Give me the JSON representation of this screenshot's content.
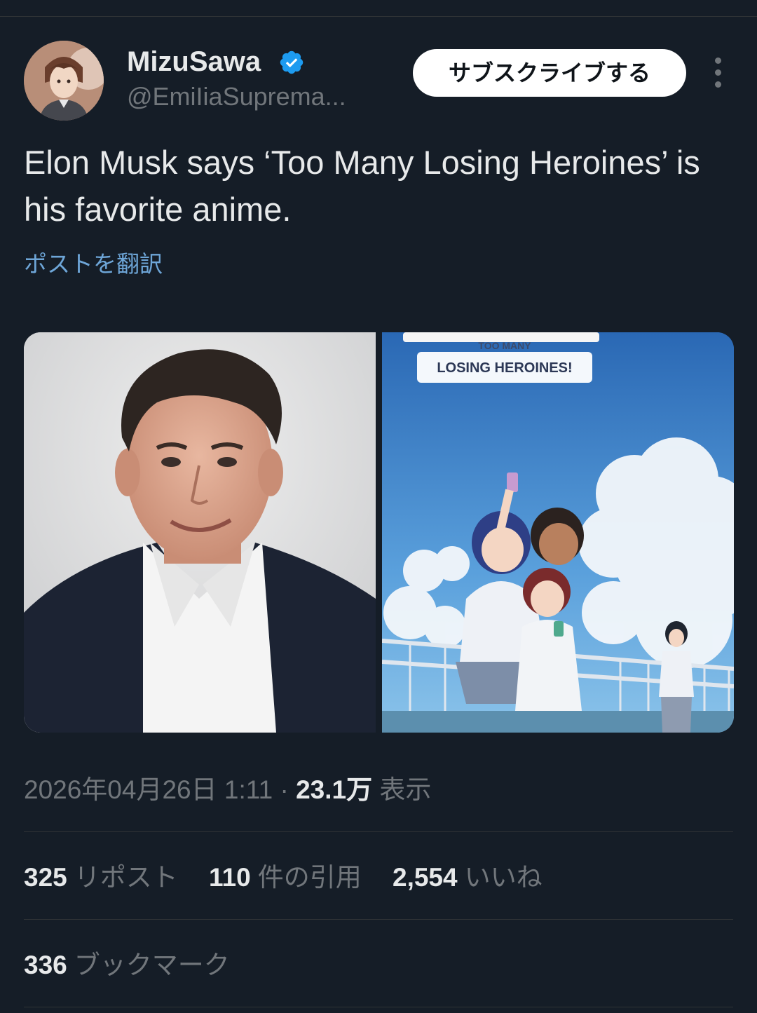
{
  "author": {
    "display_name": "MizuSawa",
    "handle": "@EmiIiaSuprema..."
  },
  "header": {
    "subscribe_label": "サブスクライブする",
    "more_icon": "more-vertical-icon",
    "verified_icon": "verified-badge-icon"
  },
  "tweet": {
    "text": "Elon Musk says ‘Too Many Losing Heroines’ is his favorite anime.",
    "translate_label": "ポストを翻訳"
  },
  "media": {
    "poster_logo_line1": "TOO MANY",
    "poster_logo_line2": "LOSING HEROINES!"
  },
  "meta": {
    "timestamp": "2026年04月26日 1:11",
    "separator": "·",
    "views_count": "23.1万",
    "views_label": "表示"
  },
  "stats": {
    "reposts_count": "325",
    "reposts_label": "リポスト",
    "quotes_count": "110",
    "quotes_label": "件の引用",
    "likes_count": "2,554",
    "likes_label": "いいね",
    "bookmarks_count": "336",
    "bookmarks_label": "ブックマーク"
  },
  "colors": {
    "background": "#151d27",
    "link": "#6ea6d8",
    "verified": "#1d9bf0",
    "muted": "#71767b"
  }
}
